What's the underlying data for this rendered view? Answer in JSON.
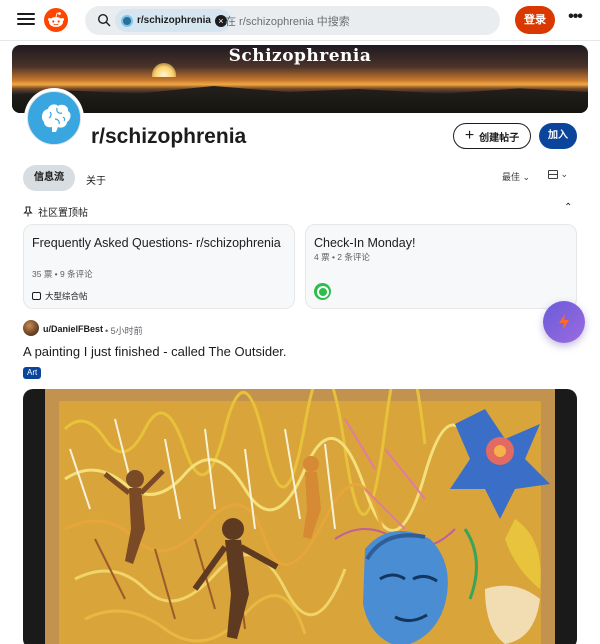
{
  "header": {
    "search_chip_label": "r/schizophrenia",
    "search_placeholder": "在 r/schizophrenia 中搜索",
    "login_label": "登录",
    "more_label": "•••"
  },
  "banner": {
    "title": "Schizophrenia"
  },
  "community": {
    "name": "r/schizophrenia",
    "create_post_label": "创建帖子",
    "join_label": "加入"
  },
  "tabs": {
    "feed_label": "信息流",
    "about_label": "关于",
    "sort_label": "最佳 ⌄",
    "view_chevron": "⌄"
  },
  "pinned": {
    "label": "社区置顶帖",
    "collapse_glyph": "⌃",
    "cards": [
      {
        "title": "Frequently Asked Questions- r/schizophrenia",
        "meta": "35 票 • 9 条评论",
        "flair": "大型综合帖"
      },
      {
        "title": "Check-In Monday!",
        "meta": "4 票 • 2 条评论"
      }
    ]
  },
  "post": {
    "user": "u/DanielFBest",
    "time": "• 5小时前",
    "title": "A painting I just finished - called The Outsider.",
    "flair": "Art"
  },
  "colors": {
    "accent_orange": "#d93900",
    "join_blue": "#0a449b",
    "reddit_logo": "#ff4500",
    "fab_purple": "#6a5bd8"
  },
  "icons": [
    "menu-icon",
    "reddit-logo-icon",
    "search-icon",
    "close-icon",
    "more-icon",
    "plus-icon",
    "pin-icon",
    "chevron-up-icon",
    "chat-icon",
    "lightning-icon",
    "layout-icon"
  ]
}
